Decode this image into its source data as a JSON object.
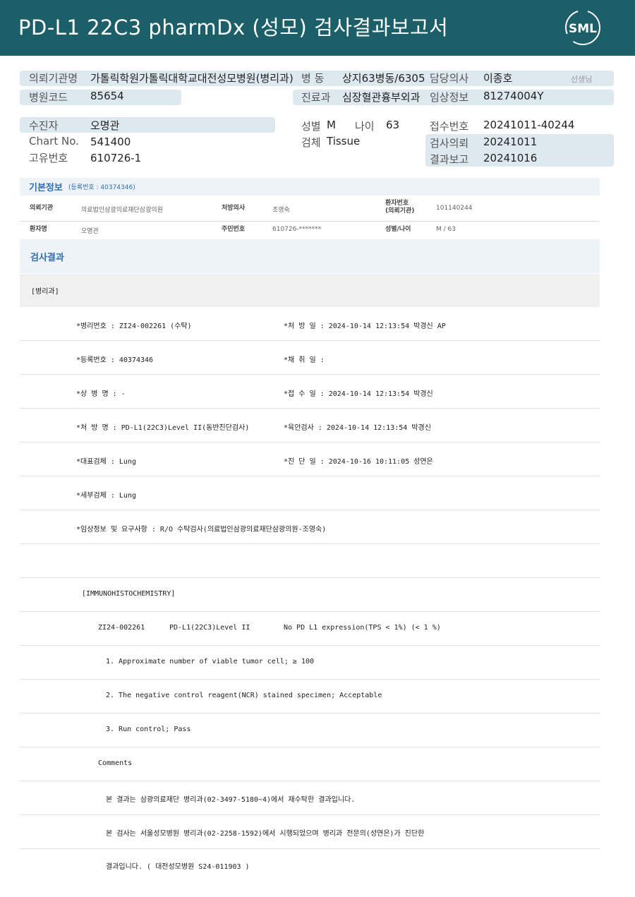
{
  "header": {
    "title": "PD-L1 22C3 pharmDx (성모) 검사결과보고서",
    "logo_text": "SML",
    "color": "#1c5f68"
  },
  "summary": {
    "institution_label": "의뢰기관명",
    "institution_value": "가톨릭학원가톨릭대학교대전성모병원(병리과)",
    "ward_label": "병 동",
    "ward_value": "상지63병동/6305",
    "doctor_label": "담당의사",
    "doctor_value": "이종호",
    "teacher_label": "선생님",
    "hospital_code_label": "병원코드",
    "hospital_code_value": "85654",
    "dept_label": "진료과",
    "dept_value": "심장혈관흉부외과",
    "clinical_label": "임상정보",
    "clinical_value": "81274004Y",
    "patient_label": "수진자",
    "patient_value": "오명관",
    "sex_label": "성별",
    "sex_value": "M",
    "age_label": "나이",
    "age_value": "63",
    "receipt_label": "접수번호",
    "receipt_value": "20241011-40244",
    "chart_label": "Chart No.",
    "chart_value": "541400",
    "specimen_label": "검체",
    "specimen_value": "Tissue",
    "request_label": "검사의뢰",
    "request_value": "20241011",
    "unique_label": "고유번호",
    "unique_value": "610726-1",
    "report_label": "결과보고",
    "report_value": "20241016"
  },
  "basic_info": {
    "title": "기본정보",
    "reg_label": "(등록번호 : 40374346)",
    "inst_label": "의뢰기관",
    "inst_value": "의료법인삼광의료재단삼광의원",
    "rx_doctor_label": "처방의사",
    "rx_doctor_value": "조영숙",
    "patient_no_label_1": "환자번호",
    "patient_no_label_2": "(의뢰기관)",
    "patient_no_value": "101140244",
    "patient_name_label": "환자명",
    "patient_name_value": "오명관",
    "rrn_label": "주민번호",
    "rrn_value": "610726-*******",
    "sex_age_label": "성별/나이",
    "sex_age_value": "M / 63"
  },
  "results": {
    "title": "검사결과",
    "section": "[병리과]",
    "rows": [
      {
        "left": "*병리번호 : ZI24-002261 (수탁)",
        "right": "*처 방 일 : 2024-10-14 12:13:54  박경신 AP"
      },
      {
        "left": "*등록번호 : 40374346",
        "right": "*채 취 일 :"
      },
      {
        "left": "*상 병 명 : -",
        "right": "*접 수 일 : 2024-10-14 12:13:54  박경신"
      },
      {
        "left": "*처 방 명 : PD-L1(22C3)Level II(동반진단검사)",
        "right": "*육안검사 : 2024-10-14 12:13:54  박경신"
      },
      {
        "left": "*대표검체 : Lung",
        "right": "*진 단 일 : 2024-10-16 10:11:05  성연은"
      },
      {
        "left": "*세부검체 : Lung",
        "right": ""
      },
      {
        "left": "*임상정보 및 요구사항 : R/O 수탁검사(의료법인삼광의료재단삼광의원-조영숙)",
        "right": ""
      }
    ],
    "ihc_header": "[IMMUNOHISTOCHEMISTRY]",
    "ihc_id": "ZI24-002261",
    "ihc_test": "PD-L1(22C3)Level II",
    "ihc_result": "No PD L1 expression(TPS < 1%) (< 1 %)",
    "items": [
      "1. Approximate number of viable tumor cell; ≥ 100",
      "2. The negative control reagent(NCR) stained specimen; Acceptable",
      "3. Run control; Pass"
    ],
    "comments_label": "Comments",
    "comments": [
      "본 결과는 삼광의료재단 병리과(02-3497-5180~4)에서 재수탁한 결과입니다.",
      "본 검사는 서울성모병원 병리과(02-2258-1592)에서 시행되었으며 병리과 전문의(성연은)가 진단한",
      "결과입니다. ( 대전성모병원 S24-011903 )"
    ]
  }
}
